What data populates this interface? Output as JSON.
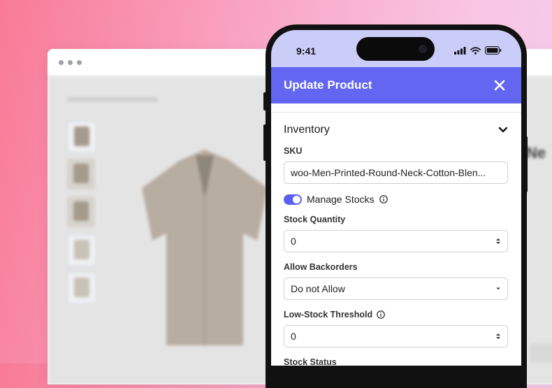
{
  "status_bar": {
    "time": "9:41"
  },
  "modal": {
    "title": "Update Product",
    "close_icon": "close-icon",
    "section": {
      "title": "Inventory",
      "icon": "chevron-down-icon"
    },
    "sku": {
      "label": "SKU",
      "value": "woo-Men-Printed-Round-Neck-Cotton-Blen..."
    },
    "manage_stocks": {
      "label": "Manage Stocks",
      "enabled": true
    },
    "stock_quantity": {
      "label": "Stock Quantity",
      "value": "0"
    },
    "allow_backorders": {
      "label": "Allow Backorders",
      "value": "Do not Allow"
    },
    "low_stock_threshold": {
      "label": "Low-Stock Threshold",
      "value": "0"
    },
    "stock_status": {
      "label": "Stock Status"
    }
  },
  "colors": {
    "accent": "#6266f0",
    "status_bar": "#cbcdf9",
    "toggle": "#5b5ff0"
  }
}
